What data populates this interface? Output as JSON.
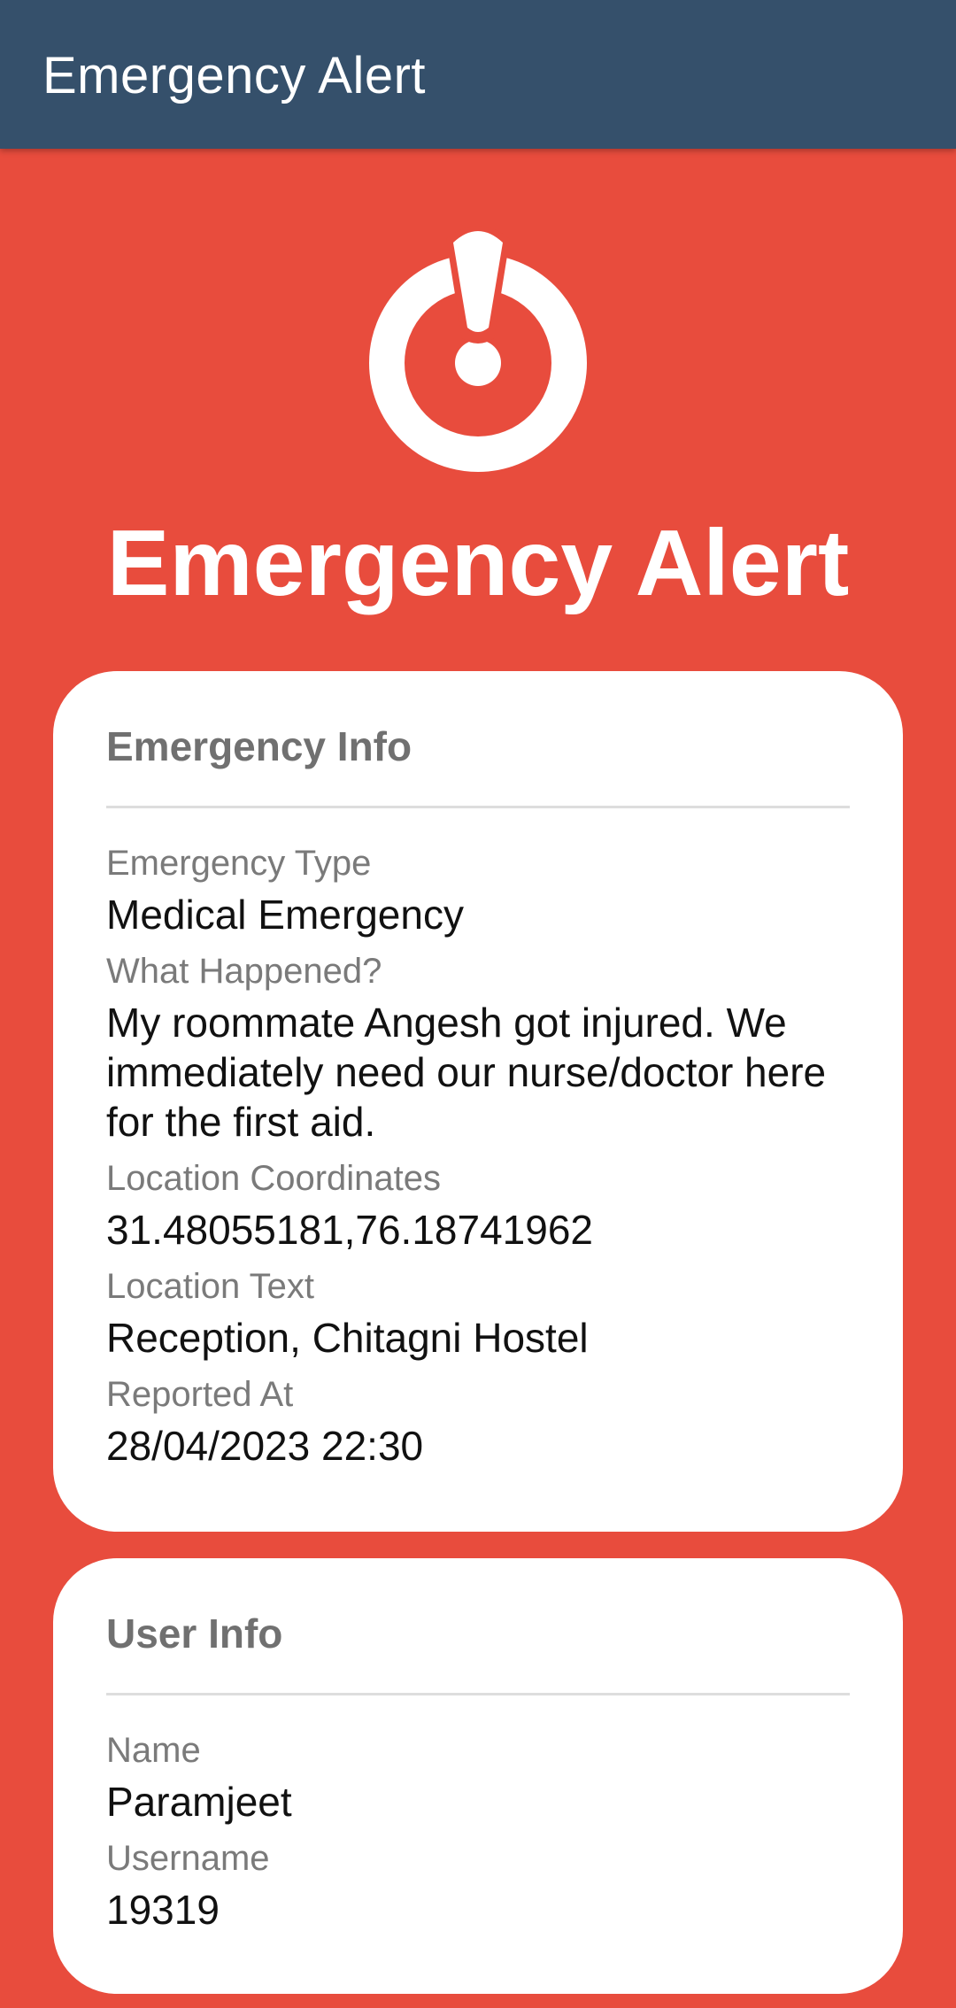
{
  "app_bar": {
    "title": "Emergency Alert"
  },
  "hero": {
    "icon": "alert-siren-icon",
    "title": "Emergency Alert"
  },
  "emergency_info": {
    "title": "Emergency Info",
    "fields": [
      {
        "label": "Emergency Type",
        "value": "Medical Emergency"
      },
      {
        "label": "What Happened?",
        "value": "My roommate Angesh got injured. We immediately need our nurse/doctor here for the first aid."
      },
      {
        "label": "Location Coordinates",
        "value": "31.48055181,76.18741962"
      },
      {
        "label": "Location Text",
        "value": "Reception, Chitagni Hostel"
      },
      {
        "label": "Reported At",
        "value": "28/04/2023 22:30"
      }
    ]
  },
  "user_info": {
    "title": "User Info",
    "fields": [
      {
        "label": "Name",
        "value": "Paramjeet"
      },
      {
        "label": "Username",
        "value": "19319"
      }
    ]
  },
  "colors": {
    "app_bar": "#35506B",
    "background": "#E84C3D",
    "card": "#FFFFFF"
  }
}
